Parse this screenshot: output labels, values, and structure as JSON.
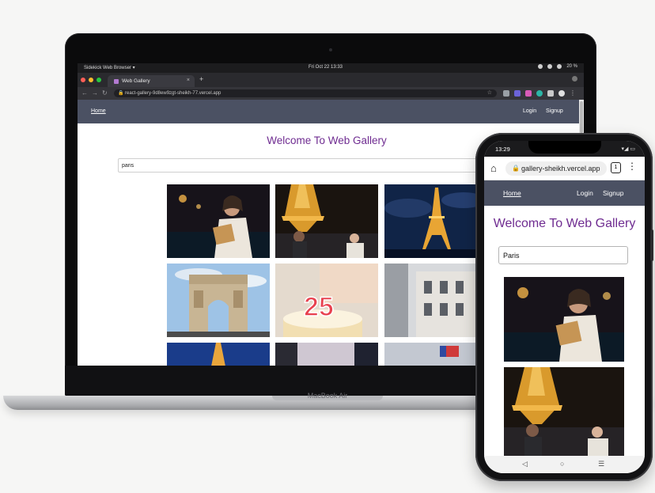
{
  "laptop": {
    "model_label": "MacBook Air",
    "os_bar": {
      "app_menu": "Sidekick Web Browser ▾",
      "clock": "Fri Oct 22  13:33",
      "battery": "20 %"
    },
    "browser": {
      "tab_title": "Web Gallery",
      "tab_close": "×",
      "new_tab": "+",
      "url": "react-gallery-9d8ew9zgt-sheikh-77.vercel.app"
    },
    "page": {
      "nav": {
        "home": "Home",
        "login": "Login",
        "signup": "Signup"
      },
      "title": "Welcome To Web Gallery",
      "search_value": "paris",
      "cake_number": "25"
    }
  },
  "phone": {
    "status_time": "13:29",
    "status_right": "▾◢ ▭",
    "url": "gallery-sheikh.vercel.app",
    "tab_count": "1",
    "nav": {
      "home": "Home",
      "login": "Login",
      "signup": "Signup"
    },
    "title": "Welcome To Web Gallery",
    "search_value": "Paris",
    "bottom_nav": {
      "back": "◁",
      "home": "○",
      "recents": "☰"
    }
  },
  "colors": {
    "nav_bg": "#4b5163",
    "title_purple": "#6f2c91"
  }
}
